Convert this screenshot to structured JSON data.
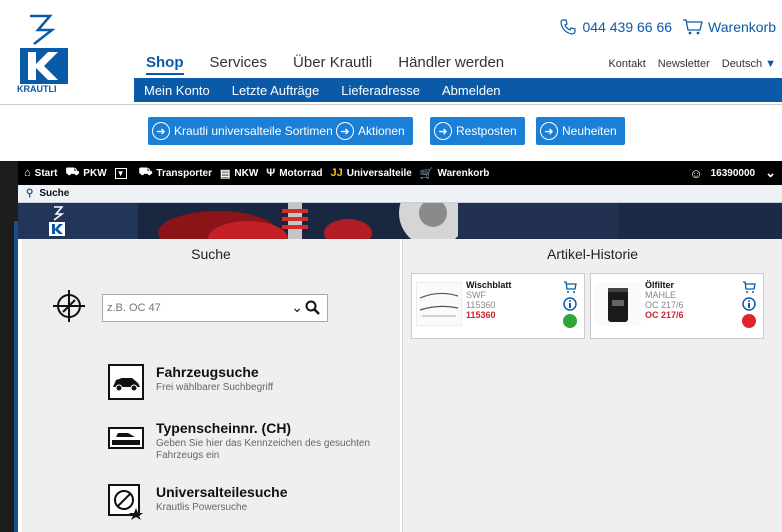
{
  "header": {
    "logo_text": "KRAUTLI",
    "phone": "044 439 66 66",
    "cart_label": "Warenkorb",
    "main_nav": [
      "Shop",
      "Services",
      "Über Krautli",
      "Händler werden"
    ],
    "top_links": [
      "Kontakt",
      "Newsletter",
      "Deutsch"
    ],
    "sub_nav": [
      "Mein Konto",
      "Letzte Aufträge",
      "Lieferadresse",
      "Abmelden"
    ]
  },
  "shortcuts": [
    "Krautli universalteile Sortiment",
    "Aktionen",
    "Restposten",
    "Neuheiten"
  ],
  "appbar": {
    "items": [
      "Start",
      "PKW",
      "Transporter",
      "NKW",
      "Motorrad",
      "Universalteile",
      "Warenkorb"
    ],
    "account": "16390000"
  },
  "tab": {
    "label": "Suche"
  },
  "search_pane": {
    "title": "Suche",
    "placeholder": "z.B. OC 47",
    "options": [
      {
        "title": "Fahrzeugsuche",
        "subtitle": "Frei wählbarer Suchbegriff"
      },
      {
        "title": "Typenscheinnr. (CH)",
        "subtitle": "Geben Sie hier das Kennzeichen des gesuchten Fahrzeugs ein"
      },
      {
        "title": "Universalteilesuche",
        "subtitle": "Krautlis Powersuche"
      }
    ]
  },
  "history": {
    "title": "Artikel-Historie",
    "items": [
      {
        "name": "Wischblatt",
        "brand": "SWF",
        "number": "115360",
        "code": "115360",
        "status_color": "#2fa63a"
      },
      {
        "name": "Ölfilter",
        "brand": "MAHLE",
        "number": "OC 217/6",
        "code": "OC 217/6",
        "status_color": "#e0242c"
      }
    ]
  },
  "colors": {
    "brand_blue": "#0b5aa8",
    "button_blue": "#1b7fd6",
    "appbar": "#000000"
  }
}
